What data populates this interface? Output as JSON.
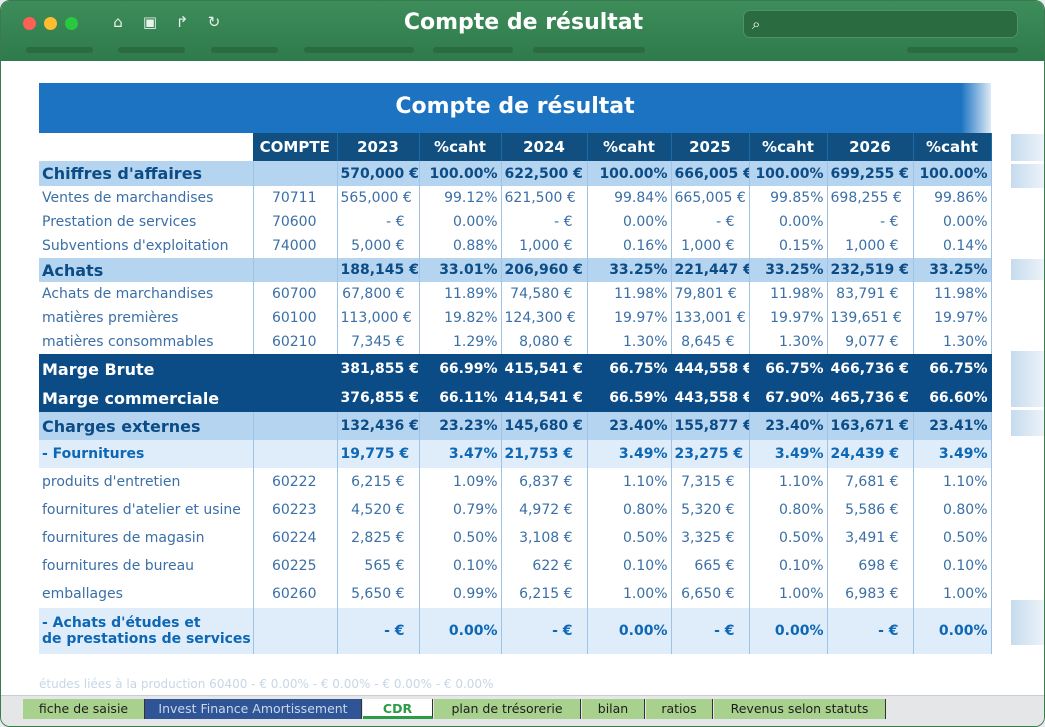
{
  "window": {
    "title": "Compte de résultat"
  },
  "colors": {
    "accent": "#2f7a4b",
    "header": "#1b73c2",
    "dark": "#0c4c86"
  },
  "sheet": {
    "banner": "Compte de résultat",
    "headers": [
      "COMPTE",
      "2023",
      "%caht",
      "2024",
      "%caht",
      "2025",
      "%caht",
      "2026",
      "%caht"
    ],
    "rows": [
      {
        "type": "sec",
        "label": "Chiffres d'affaires",
        "code": "",
        "vals": [
          "570,000 €",
          "100.00%",
          "622,500 €",
          "100.00%",
          "666,005 €",
          "100.00%",
          "699,255 €",
          "100.00%"
        ]
      },
      {
        "type": "norm",
        "label": "Ventes de marchandises",
        "code": "70711",
        "vals": [
          "565,000 €",
          "99.12%",
          "621,500 €",
          "99.84%",
          "665,005 €",
          "99.85%",
          "698,255 €",
          "99.86%"
        ]
      },
      {
        "type": "norm",
        "label": "Prestation de services",
        "code": "70600",
        "vals": [
          "-  €",
          "0.00%",
          "-  €",
          "0.00%",
          "-  €",
          "0.00%",
          "-  €",
          "0.00%"
        ]
      },
      {
        "type": "norm",
        "label": "Subventions d'exploitation",
        "code": "74000",
        "vals": [
          "5,000 €",
          "0.88%",
          "1,000 €",
          "0.16%",
          "1,000 €",
          "0.15%",
          "1,000 €",
          "0.14%"
        ]
      },
      {
        "type": "sec",
        "label": "Achats",
        "code": "",
        "vals": [
          "188,145 €",
          "33.01%",
          "206,960 €",
          "33.25%",
          "221,447 €",
          "33.25%",
          "232,519 €",
          "33.25%"
        ]
      },
      {
        "type": "norm",
        "label": "Achats de marchandises",
        "code": "60700",
        "vals": [
          "67,800 €",
          "11.89%",
          "74,580 €",
          "11.98%",
          "79,801 €",
          "11.98%",
          "83,791 €",
          "11.98%"
        ]
      },
      {
        "type": "norm",
        "label": "matières premières",
        "code": "60100",
        "vals": [
          "113,000 €",
          "19.82%",
          "124,300 €",
          "19.97%",
          "133,001 €",
          "19.97%",
          "139,651 €",
          "19.97%"
        ]
      },
      {
        "type": "norm",
        "label": "matières consommables",
        "code": "60210",
        "vals": [
          "7,345 €",
          "1.29%",
          "8,080 €",
          "1.30%",
          "8,645 €",
          "1.30%",
          "9,077 €",
          "1.30%"
        ]
      },
      {
        "type": "dark",
        "label": "Marge Brute",
        "code": "",
        "vals": [
          "381,855 €",
          "66.99%",
          "415,541 €",
          "66.75%",
          "444,558 €",
          "66.75%",
          "466,736 €",
          "66.75%"
        ]
      },
      {
        "type": "dark",
        "label": "Marge commerciale",
        "code": "",
        "vals": [
          "376,855 €",
          "66.11%",
          "414,541 €",
          "66.59%",
          "443,558 €",
          "67.90%",
          "465,736 €",
          "66.60%"
        ]
      },
      {
        "type": "sec",
        "label": "Charges externes",
        "code": "",
        "vals": [
          "132,436 €",
          "23.23%",
          "145,680 €",
          "23.40%",
          "155,877 €",
          "23.40%",
          "163,671 €",
          "23.41%"
        ]
      },
      {
        "type": "sub",
        "label": " - Fournitures",
        "code": "",
        "vals": [
          "19,775 €",
          "3.47%",
          "21,753 €",
          "3.49%",
          "23,275 €",
          "3.49%",
          "24,439 €",
          "3.49%"
        ]
      },
      {
        "type": "norm",
        "label": "produits d'entretien",
        "code": "60222",
        "vals": [
          "6,215 €",
          "1.09%",
          "6,837 €",
          "1.10%",
          "7,315 €",
          "1.10%",
          "7,681 €",
          "1.10%"
        ]
      },
      {
        "type": "norm",
        "label": "fournitures d'atelier et usine",
        "code": "60223",
        "vals": [
          "4,520 €",
          "0.79%",
          "4,972 €",
          "0.80%",
          "5,320 €",
          "0.80%",
          "5,586 €",
          "0.80%"
        ]
      },
      {
        "type": "norm",
        "label": "fournitures de magasin",
        "code": "60224",
        "vals": [
          "2,825 €",
          "0.50%",
          "3,108 €",
          "0.50%",
          "3,325 €",
          "0.50%",
          "3,491 €",
          "0.50%"
        ]
      },
      {
        "type": "norm",
        "label": "fournitures de bureau",
        "code": "60225",
        "vals": [
          "565 €",
          "0.10%",
          "622 €",
          "0.10%",
          "665 €",
          "0.10%",
          "698 €",
          "0.10%"
        ]
      },
      {
        "type": "norm",
        "label": "emballages",
        "code": "60260",
        "vals": [
          "5,650 €",
          "0.99%",
          "6,215 €",
          "1.00%",
          "6,650 €",
          "1.00%",
          "6,983 €",
          "1.00%"
        ]
      },
      {
        "type": "sub2",
        "label": " - Achats d'études et",
        "label2": "de prestations de services",
        "code": "",
        "vals": [
          "-  €",
          "0.00%",
          "-  €",
          "0.00%",
          "-  €",
          "0.00%",
          "-  €",
          "0.00%"
        ]
      }
    ],
    "faint_row": "études liées à la production      60400          -  €       0.00%        -  €       0.00%        -  €       0.00%        -  €       0.00%"
  },
  "tabs": [
    {
      "label": "fiche de saisie",
      "style": "green"
    },
    {
      "label": "Invest Finance Amortissement",
      "style": "blue"
    },
    {
      "label": "CDR",
      "style": "active"
    },
    {
      "label": "plan de trésorerie",
      "style": "green"
    },
    {
      "label": "bilan",
      "style": "green"
    },
    {
      "label": "ratios",
      "style": "green"
    },
    {
      "label": "Revenus selon statuts",
      "style": "green"
    }
  ]
}
